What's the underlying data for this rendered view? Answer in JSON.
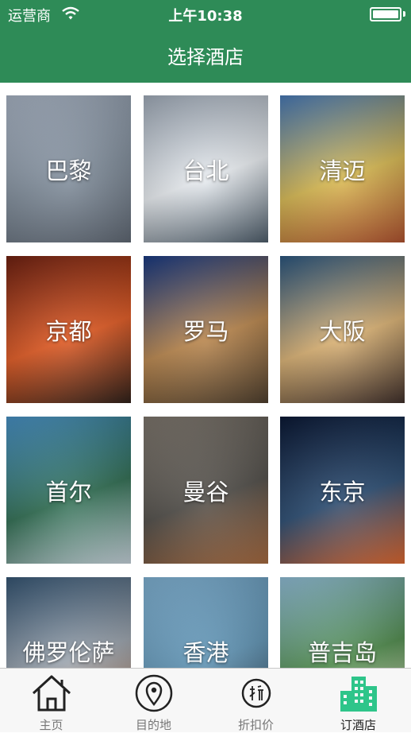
{
  "status_bar": {
    "carrier": "运营商",
    "time": "上午10:38"
  },
  "nav": {
    "title": "选择酒店"
  },
  "destinations": [
    {
      "label": "巴黎",
      "colors": [
        "#b9c6d8",
        "#7f8c9a",
        "#5d6672"
      ]
    },
    {
      "label": "台北",
      "colors": [
        "#b0bccb",
        "#e9edf1",
        "#4a5a68"
      ]
    },
    {
      "label": "清迈",
      "colors": [
        "#4f86c9",
        "#d7b84f",
        "#b14e2a"
      ]
    },
    {
      "label": "京都",
      "colors": [
        "#7a2413",
        "#e0571f",
        "#2a1b14"
      ]
    },
    {
      "label": "罗马",
      "colors": [
        "#1b3f8f",
        "#b8844a",
        "#4a3a28"
      ]
    },
    {
      "label": "大阪",
      "colors": [
        "#2f5f8c",
        "#d9b071",
        "#3b2a25"
      ]
    },
    {
      "label": "首尔",
      "colors": [
        "#4f9fd8",
        "#2c6b4f",
        "#c9d6df"
      ]
    },
    {
      "label": "曼谷",
      "colors": [
        "#8a8278",
        "#4d4a45",
        "#a8683b"
      ]
    },
    {
      "label": "东京",
      "colors": [
        "#0c1b3a",
        "#27496f",
        "#e1652a"
      ]
    },
    {
      "label": "佛罗伦萨",
      "colors": [
        "#3b5e7f",
        "#9aa3ad",
        "#b27d5a"
      ]
    },
    {
      "label": "香港",
      "colors": [
        "#8cc3e8",
        "#5e93b4",
        "#2d4456"
      ]
    },
    {
      "label": "普吉岛",
      "colors": [
        "#9fd0ec",
        "#4d8a4a",
        "#e7e2c8"
      ]
    }
  ],
  "tabs": [
    {
      "label": "主页",
      "icon": "home-icon"
    },
    {
      "label": "目的地",
      "icon": "location-pin-icon"
    },
    {
      "label": "折扣价",
      "icon": "discount-icon"
    },
    {
      "label": "订酒店",
      "icon": "hotel-buildings-icon"
    }
  ],
  "colors": {
    "nav_bar": "#2e8b57",
    "active_tab_icon": "#2ec58a"
  }
}
